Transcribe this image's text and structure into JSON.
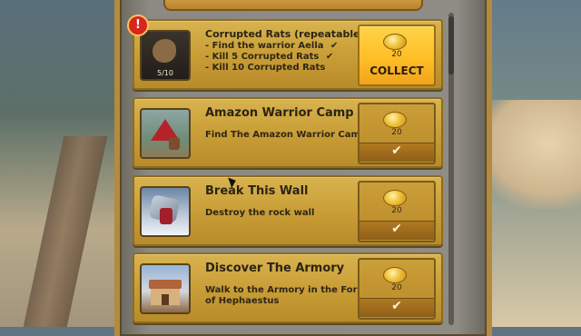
{
  "quests": [
    {
      "title": "Corrupted Rats (repeatable)",
      "objectives": [
        {
          "text": "- Find the warrior Aella",
          "done": true
        },
        {
          "text": "- Kill 5 Corrupted Rats",
          "done": true
        },
        {
          "text": "- Kill 10 Corrupted Rats",
          "done": false
        }
      ],
      "progress": "5/10",
      "reward_amount": "20",
      "action_label": "COLLECT",
      "alert": "!"
    },
    {
      "title": "Amazon Warrior Camp",
      "description": "Find The Amazon Warrior Camp",
      "reward_amount": "20",
      "completed_mark": "✔"
    },
    {
      "title": "Break This Wall",
      "description": "Destroy the rock wall",
      "reward_amount": "20",
      "completed_mark": "✔"
    },
    {
      "title": "Discover The Armory",
      "description": "Walk to the Armory in the Forge of Hephaestus",
      "reward_amount": "20",
      "completed_mark": "✔"
    }
  ],
  "check_glyph": "✔",
  "icons": {
    "reward": "coin-icon",
    "alert": "exclamation-icon",
    "q1_thumb": "rat-icon",
    "q2_thumb": "camp-icon",
    "q3_thumb": "rock-wall-icon",
    "q4_thumb": "armory-icon"
  },
  "colors": {
    "card": "#c89c35",
    "collect": "#ffbe26",
    "alert": "#d8251f"
  }
}
